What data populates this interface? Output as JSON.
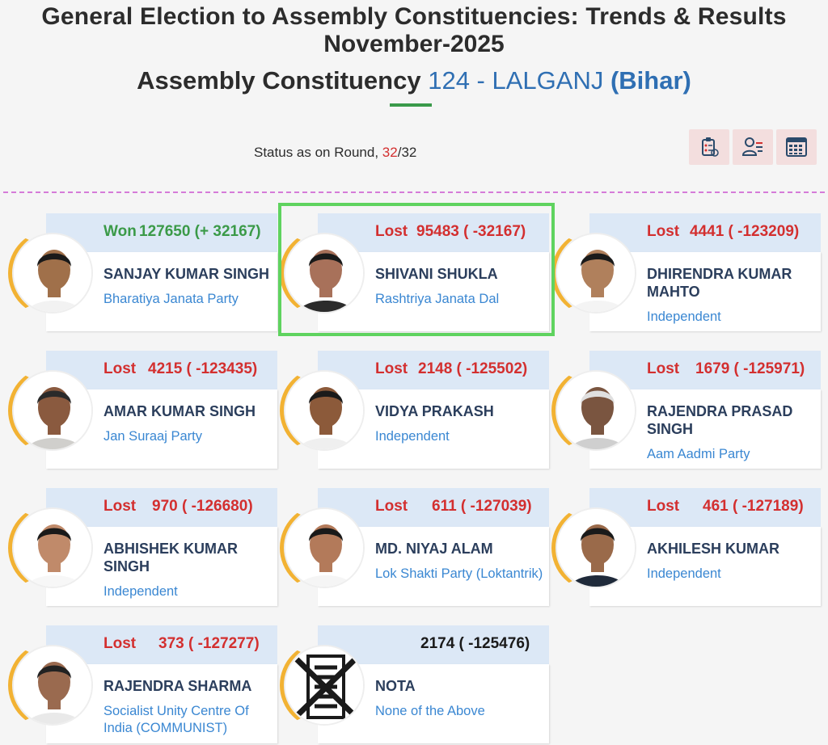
{
  "header": {
    "title_line1": "General Election to Assembly Constituencies: Trends & Results",
    "title_line2": "November-2025",
    "ac_prefix": "Assembly Constituency",
    "ac_number": "124 - LALGANJ",
    "ac_state": "(Bihar)"
  },
  "status": {
    "label": "Status as on Round,",
    "current_round": "32",
    "separator": "/",
    "total_rounds": "32"
  },
  "toolbar": {
    "icons": [
      "clipboard-icon",
      "user-list-icon",
      "calendar-grid-icon"
    ]
  },
  "colors": {
    "won": "#3b9a48",
    "lost": "#d32f2f",
    "party": "#3a87d2",
    "card_header": "#dce8f6",
    "ring": "#f2b233",
    "highlight": "#5fd35f"
  },
  "candidates": [
    {
      "status": "Won",
      "votes": "127650 (+ 32167)",
      "name": "SANJAY KUMAR SINGH",
      "party": "Bharatiya Janata Party"
    },
    {
      "status": "Lost",
      "votes": "95483 ( -32167)",
      "name": "SHIVANI SHUKLA",
      "party": "Rashtriya Janata Dal"
    },
    {
      "status": "Lost",
      "votes": "4441 ( -123209)",
      "name": "DHIRENDRA KUMAR MAHTO",
      "party": "Independent"
    },
    {
      "status": "Lost",
      "votes": "4215 ( -123435)",
      "name": "AMAR KUMAR SINGH",
      "party": "Jan Suraaj Party"
    },
    {
      "status": "Lost",
      "votes": "2148 ( -125502)",
      "name": "VIDYA PRAKASH",
      "party": "Independent"
    },
    {
      "status": "Lost",
      "votes": "1679 ( -125971)",
      "name": "RAJENDRA PRASAD SINGH",
      "party": "Aam Aadmi Party"
    },
    {
      "status": "Lost",
      "votes": "970 ( -126680)",
      "name": "ABHISHEK KUMAR SINGH",
      "party": "Independent"
    },
    {
      "status": "Lost",
      "votes": "611 ( -127039)",
      "name": "MD. NIYAJ ALAM",
      "party": "Lok Shakti Party (Loktantrik)"
    },
    {
      "status": "Lost",
      "votes": "461 ( -127189)",
      "name": "AKHILESH KUMAR",
      "party": "Independent"
    },
    {
      "status": "Lost",
      "votes": "373 ( -127277)",
      "name": "RAJENDRA SHARMA",
      "party": "Socialist Unity Centre Of India (COMMUNIST)"
    },
    {
      "status": "",
      "votes": "2174 ( -125476)",
      "name": "NOTA",
      "party": "None of the Above"
    }
  ]
}
